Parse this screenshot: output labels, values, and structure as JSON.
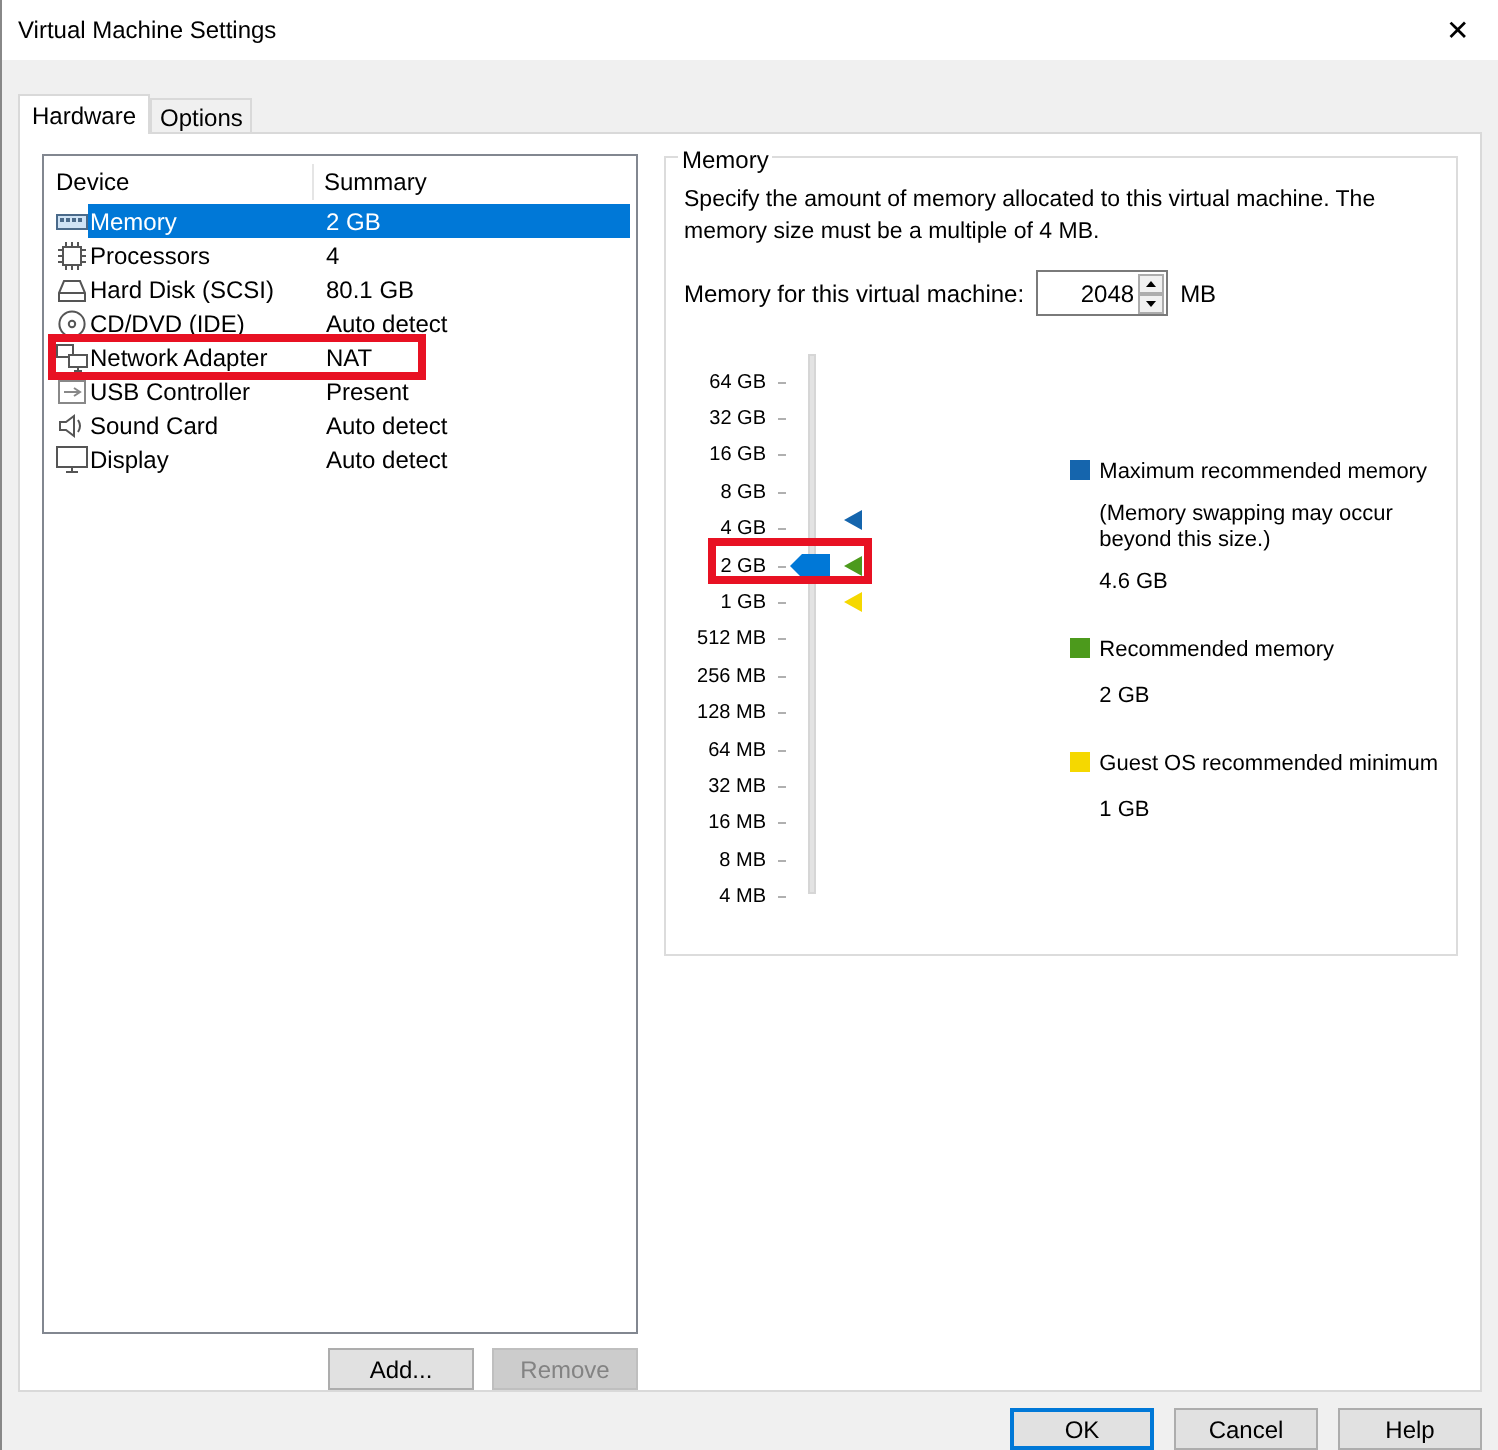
{
  "window": {
    "title": "Virtual Machine Settings",
    "close": "✕"
  },
  "tabs": [
    {
      "label": "Hardware",
      "selected": true
    },
    {
      "label": "Options",
      "selected": false
    }
  ],
  "devices": {
    "columns": [
      "Device",
      "Summary"
    ],
    "rows": [
      {
        "kind": "memory",
        "device": "Memory",
        "summary": "2 GB",
        "selected": true,
        "highlighted": false
      },
      {
        "kind": "cpu",
        "device": "Processors",
        "summary": "4",
        "selected": false,
        "highlighted": false
      },
      {
        "kind": "disk",
        "device": "Hard Disk (SCSI)",
        "summary": "80.1 GB",
        "selected": false,
        "highlighted": false
      },
      {
        "kind": "cd",
        "device": "CD/DVD (IDE)",
        "summary": "Auto detect",
        "selected": false,
        "highlighted": false
      },
      {
        "kind": "network",
        "device": "Network Adapter",
        "summary": "NAT",
        "selected": false,
        "highlighted": true
      },
      {
        "kind": "usb",
        "device": "USB Controller",
        "summary": "Present",
        "selected": false,
        "highlighted": false
      },
      {
        "kind": "sound",
        "device": "Sound Card",
        "summary": "Auto detect",
        "selected": false,
        "highlighted": false
      },
      {
        "kind": "display",
        "device": "Display",
        "summary": "Auto detect",
        "selected": false,
        "highlighted": false
      }
    ],
    "buttons": [
      {
        "label": "Add...",
        "disabled": false
      },
      {
        "label": "Remove",
        "disabled": true
      }
    ]
  },
  "memory": {
    "title": "Memory",
    "description": "Specify the amount of memory allocated to this virtual machine. The memory size must be a multiple of 4 MB.",
    "field_label": "Memory for this virtual machine:",
    "value": "2048",
    "unit": "MB",
    "scale": [
      {
        "label": "64 GB",
        "selected": false,
        "highlighted": false
      },
      {
        "label": "32 GB",
        "selected": false,
        "highlighted": false
      },
      {
        "label": "16 GB",
        "selected": false,
        "highlighted": false
      },
      {
        "label": "8 GB",
        "selected": false,
        "highlighted": false
      },
      {
        "label": "4 GB",
        "selected": false,
        "highlighted": false,
        "color": "#1565ad"
      },
      {
        "label": "2 GB",
        "selected": true,
        "highlighted": true,
        "color": "#4c9a1c"
      },
      {
        "label": "1 GB",
        "selected": false,
        "highlighted": false,
        "color": "#f5d800"
      },
      {
        "label": "512 MB",
        "selected": false,
        "highlighted": false
      },
      {
        "label": "256 MB",
        "selected": false,
        "highlighted": false
      },
      {
        "label": "128 MB",
        "selected": false,
        "highlighted": false
      },
      {
        "label": "64 MB",
        "selected": false,
        "highlighted": false
      },
      {
        "label": "32 MB",
        "selected": false,
        "highlighted": false
      },
      {
        "label": "16 MB",
        "selected": false,
        "highlighted": false
      },
      {
        "label": "8 MB",
        "selected": false,
        "highlighted": false
      },
      {
        "label": "4 MB",
        "selected": false,
        "highlighted": false
      }
    ],
    "legend": [
      {
        "color": "#1565ad",
        "title": "Maximum recommended memory",
        "note": "(Memory swapping may occur beyond this size.)",
        "value": "4.6 GB"
      },
      {
        "color": "#4c9a1c",
        "title": "Recommended memory",
        "value": "2 GB"
      },
      {
        "color": "#f5d800",
        "title": "Guest OS recommended minimum",
        "value": "1 GB"
      }
    ]
  },
  "footer_buttons": [
    {
      "label": "OK",
      "default": true
    },
    {
      "label": "Cancel",
      "default": false
    },
    {
      "label": "Help",
      "default": false
    }
  ]
}
